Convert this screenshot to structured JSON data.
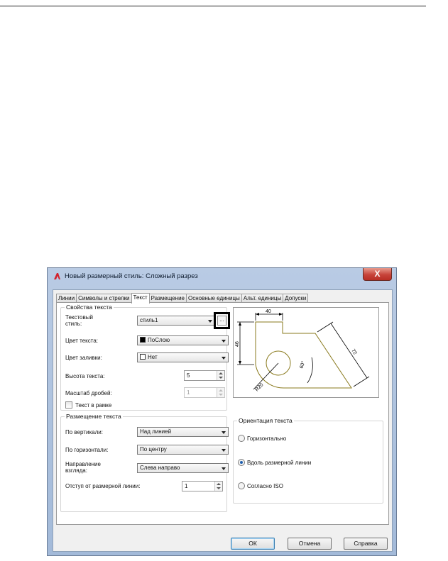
{
  "window": {
    "title": "Новый размерный стиль: Сложный разрез",
    "close_label": "X"
  },
  "tabs": [
    {
      "label": "Линии",
      "active": false
    },
    {
      "label": "Символы и стрелки",
      "active": false
    },
    {
      "label": "Текст",
      "active": true
    },
    {
      "label": "Размещение",
      "active": false
    },
    {
      "label": "Основные единицы",
      "active": false
    },
    {
      "label": "Альт. единицы",
      "active": false
    },
    {
      "label": "Допуски",
      "active": false
    }
  ],
  "text_props": {
    "title": "Свойства текста",
    "style_label": "Текстовый\nстиль:",
    "style_value": "стиль1",
    "ellipsis_label": "...",
    "color_label": "Цвет текста:",
    "color_value": "ПоСлою",
    "color_swatch": "#000000",
    "fill_label": "Цвет заливки:",
    "fill_value": "Нет",
    "fill_swatch": "#ffffff",
    "height_label": "Высота текста:",
    "height_value": "5",
    "scale_label": "Масштаб дробей:",
    "scale_value": "1",
    "frame_label": "Текст в рамке",
    "frame_checked": false
  },
  "placement": {
    "title": "Размещение текста",
    "vertical_label": "По вертикали:",
    "vertical_value": "Над линией",
    "horizontal_label": "По горизонтали:",
    "horizontal_value": "По центру",
    "direction_label": "Направление\nвзгляда:",
    "direction_value": "Слева направо",
    "offset_label": "Отступ от размерной линии:",
    "offset_value": "1"
  },
  "orientation": {
    "title": "Ориентация текста",
    "options": [
      {
        "label": "Горизонтально",
        "selected": false
      },
      {
        "label": "Вдоль размерной линии",
        "selected": true
      },
      {
        "label": "Согласно ISO",
        "selected": false
      }
    ]
  },
  "preview": {
    "dim_top": "40",
    "dim_left": "46",
    "dim_diag": "72",
    "dim_angle": "60°",
    "dim_radius": "R20",
    "outline_color": "#8a7a1e"
  },
  "buttons": {
    "ok": "ОК",
    "cancel": "Отмена",
    "help": "Справка"
  },
  "colors": {
    "title_bar": "#a3bad9",
    "close": "#c7433a",
    "app_icon": "#d2222d"
  }
}
